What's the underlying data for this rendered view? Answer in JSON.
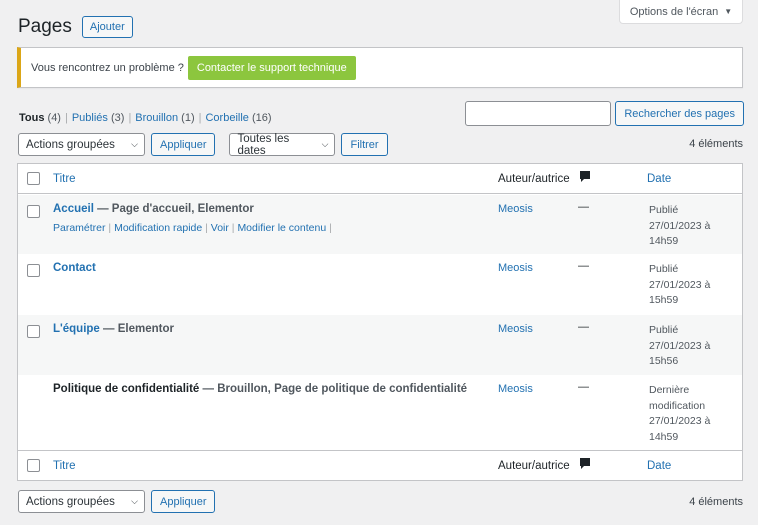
{
  "screen_options": {
    "label": "Options de l'écran"
  },
  "header": {
    "title": "Pages",
    "add_label": "Ajouter"
  },
  "notice": {
    "text": "Vous rencontrez un problème ?",
    "button": "Contacter le support technique"
  },
  "views": [
    {
      "label": "Tous",
      "count": "(4)"
    },
    {
      "label": "Publiés",
      "count": "(3)"
    },
    {
      "label": "Brouillon",
      "count": "(1)"
    },
    {
      "label": "Corbeille",
      "count": "(16)"
    }
  ],
  "search": {
    "button": "Rechercher des pages",
    "value": ""
  },
  "tablenav_top": {
    "bulk_actions": "Actions groupées",
    "apply": "Appliquer",
    "dates": "Toutes les dates",
    "filter": "Filtrer",
    "count": "4 éléments"
  },
  "columns": {
    "title": "Titre",
    "author": "Auteur/autrice",
    "date": "Date"
  },
  "rows": [
    {
      "title": "Accueil",
      "suffix": " — Page d'accueil, Elementor",
      "actions": [
        "Paramétrer",
        "Modification rapide",
        "Voir",
        "Modifier le contenu"
      ],
      "author": "Meosis",
      "comments": "—",
      "date": "Publié 27/01/2023 à 14h59"
    },
    {
      "title": "Contact",
      "suffix": "",
      "author": "Meosis",
      "comments": "—",
      "date": "Publié 27/01/2023 à 15h59"
    },
    {
      "title": "L'équipe",
      "suffix": " — Elementor",
      "author": "Meosis",
      "comments": "—",
      "date": "Publié 27/01/2023 à 15h56"
    },
    {
      "title": "Politique de confidentialité",
      "suffix": " — Brouillon, Page de politique de confidentialité",
      "author": "Meosis",
      "comments": "—",
      "date": "Dernière modification 27/01/2023 à 14h59"
    }
  ],
  "tablenav_bottom": {
    "bulk_actions": "Actions groupées",
    "apply": "Appliquer",
    "count": "4 éléments"
  }
}
